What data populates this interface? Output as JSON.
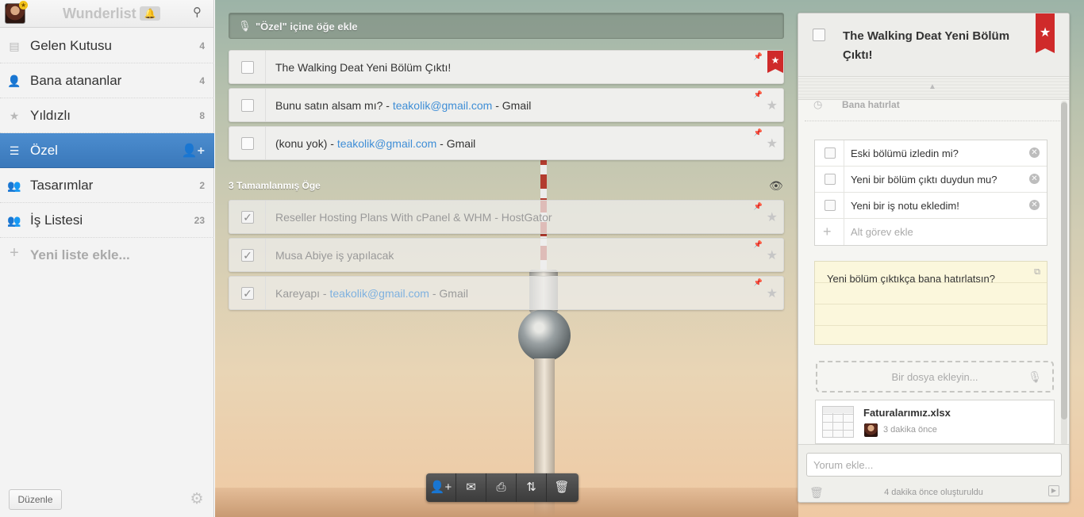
{
  "app": {
    "title": "Wunderlist"
  },
  "sidebar": {
    "items": [
      {
        "label": "Gelen Kutusu",
        "count": "4",
        "icon": "inbox-icon"
      },
      {
        "label": "Bana atananlar",
        "count": "4",
        "icon": "assigned-user-icon"
      },
      {
        "label": "Yıldızlı",
        "count": "8",
        "icon": "star-icon"
      },
      {
        "label": "Özel",
        "count": "",
        "icon": "list-icon"
      },
      {
        "label": "Tasarımlar",
        "count": "2",
        "icon": "shared-list-icon"
      },
      {
        "label": "İş Listesi",
        "count": "23",
        "icon": "shared-list-icon"
      }
    ],
    "add_list": "Yeni liste ekle...",
    "edit_button": "Düzenle"
  },
  "main": {
    "add_placeholder": "\"Özel\" içine öğe ekle",
    "tasks": [
      {
        "text": "The Walking Deat Yeni Bölüm Çıktı!",
        "starred": true
      },
      {
        "text_before": "Bunu satın alsam mı? - ",
        "link": "teakolik@gmail.com",
        "text_after": " - Gmail"
      },
      {
        "text_before": "(konu yok) - ",
        "link": "teakolik@gmail.com",
        "text_after": " - Gmail"
      }
    ],
    "completed_label": "3 Tamamlanmış Öge",
    "completed": [
      {
        "text": "Reseller Hosting Plans With cPanel & WHM - HostGator"
      },
      {
        "text": "Musa Abiye iş yapılacak"
      },
      {
        "text_before": "Kareyapı - ",
        "link": "teakolik@gmail.com",
        "text_after": " - Gmail"
      }
    ]
  },
  "detail": {
    "title": "The Walking Deat Yeni Bölüm Çıktı!",
    "reminder": "Bana hatırlat",
    "subtasks": [
      "Eski bölümü izledin mi?",
      "Yeni bir bölüm çıktı duydun mu?",
      "Yeni bir iş notu ekledim!"
    ],
    "add_subtask": "Alt görev ekle",
    "note": "Yeni bölüm çıktıkça bana hatırlatsın?",
    "file_drop": "Bir dosya ekleyin...",
    "file": {
      "name": "Faturalarımız.xlsx",
      "time": "3 dakika önce"
    },
    "comment_placeholder": "Yorum ekle...",
    "created": "4 dakika önce oluşturuldu"
  },
  "colors": {
    "accent": "#3a78ba",
    "flag": "#cf2a2a",
    "link": "#3f8ed6"
  }
}
